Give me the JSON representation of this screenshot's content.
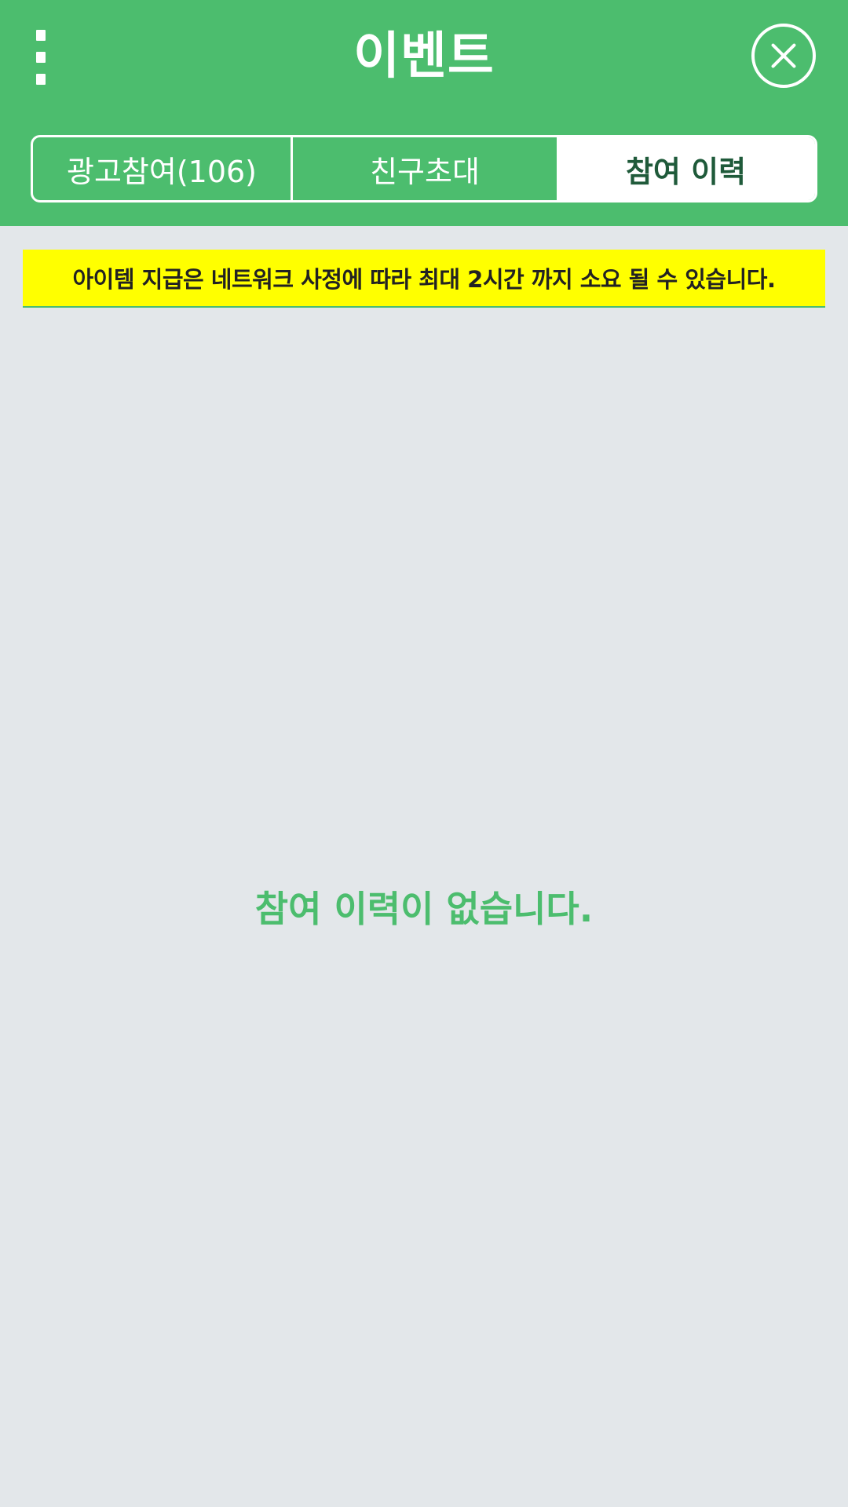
{
  "header": {
    "title": "이벤트",
    "menu_icon": "more-vertical-icon",
    "close_icon": "close-circle-icon"
  },
  "tabs": [
    {
      "label": "광고참여(106)",
      "selected": false
    },
    {
      "label": "친구초대",
      "selected": false
    },
    {
      "label": "참여 이력",
      "selected": true
    }
  ],
  "notice": {
    "text": "아이템 지급은 네트워크 사정에 따라 최대 2시간 까지 소요 될 수 있습니다."
  },
  "main": {
    "empty_message": "참여 이력이 없습니다."
  },
  "colors": {
    "brand_green": "#4cbd6e",
    "background": "#e3e7ea",
    "notice_yellow": "#ffff00",
    "selected_tab_text": "#1f5a3a"
  }
}
